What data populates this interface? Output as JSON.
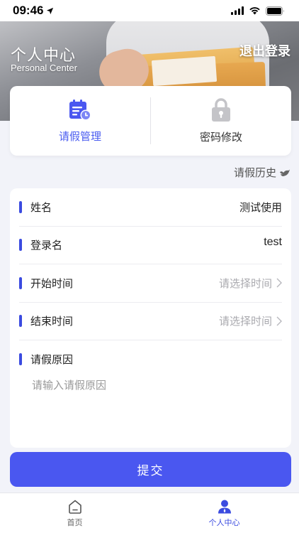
{
  "status_bar": {
    "time": "09:46"
  },
  "header": {
    "title": "个人中心",
    "subtitle": "Personal Center",
    "logout_label": "退出登录"
  },
  "actions": [
    {
      "label": "请假管理",
      "icon": "calendar-clock-icon",
      "active": true
    },
    {
      "label": "密码修改",
      "icon": "lock-icon",
      "active": false
    }
  ],
  "history_link": {
    "label": "请假历史",
    "icon": "bird-icon"
  },
  "form": {
    "name": {
      "label": "姓名",
      "value": "测试使用"
    },
    "login_name": {
      "label": "登录名",
      "value": "test"
    },
    "start_time": {
      "label": "开始时间",
      "placeholder": "请选择时间"
    },
    "end_time": {
      "label": "结束时间",
      "placeholder": "请选择时间"
    },
    "reason": {
      "label": "请假原因",
      "placeholder": "请输入请假原因"
    }
  },
  "submit_label": "提交",
  "tab_bar": {
    "tabs": [
      {
        "label": "首页",
        "icon": "home-icon",
        "active": false
      },
      {
        "label": "个人中心",
        "icon": "user-icon",
        "active": true
      }
    ]
  },
  "colors": {
    "accent": "#4a57f0",
    "bar": "#3b4be0",
    "placeholder": "#aaaaaf"
  }
}
